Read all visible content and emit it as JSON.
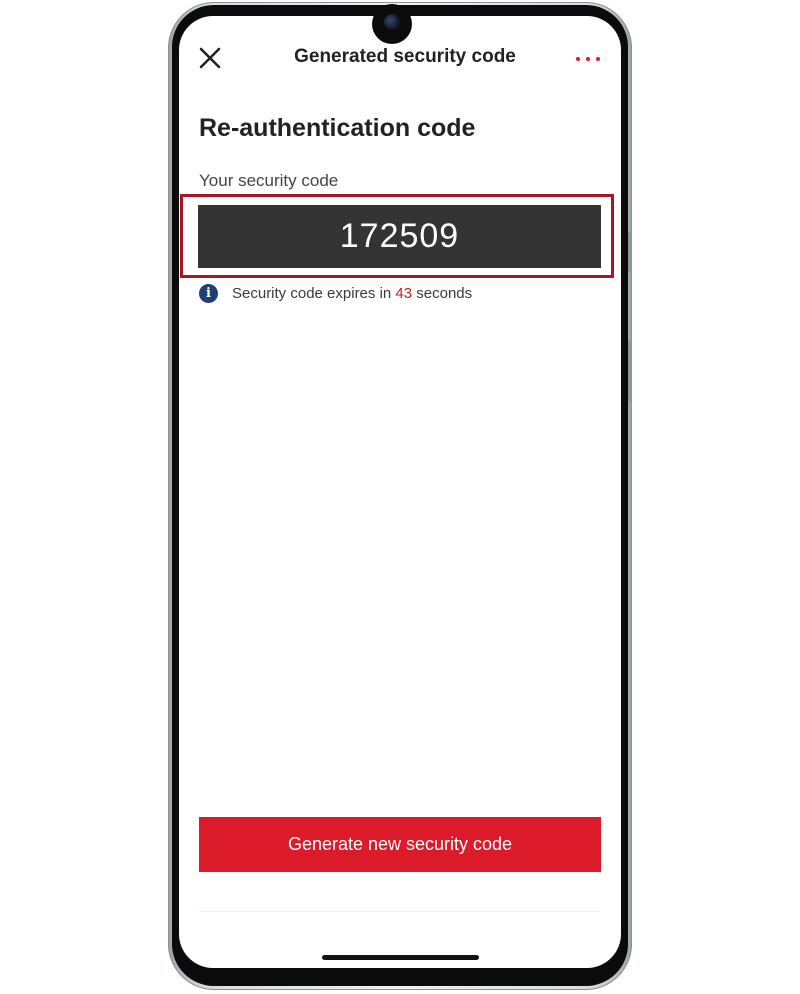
{
  "header": {
    "title": "Generated security code",
    "close_icon": "close-icon",
    "more_icon": "more-options-icon"
  },
  "main": {
    "title": "Re-authentication code",
    "code_label": "Your security code",
    "security_code": "172509",
    "expiry": {
      "icon": "info-icon",
      "icon_glyph": "i",
      "prefix": "Security code expires in",
      "seconds": "43",
      "suffix": "seconds"
    }
  },
  "footer": {
    "generate_label": "Generate new security code"
  },
  "colors": {
    "accent_red": "#dc1b2a",
    "highlight_red": "#a8161f",
    "code_box_bg": "#343434",
    "info_icon_blue": "#1d3f73",
    "countdown_red": "#b5252c"
  }
}
